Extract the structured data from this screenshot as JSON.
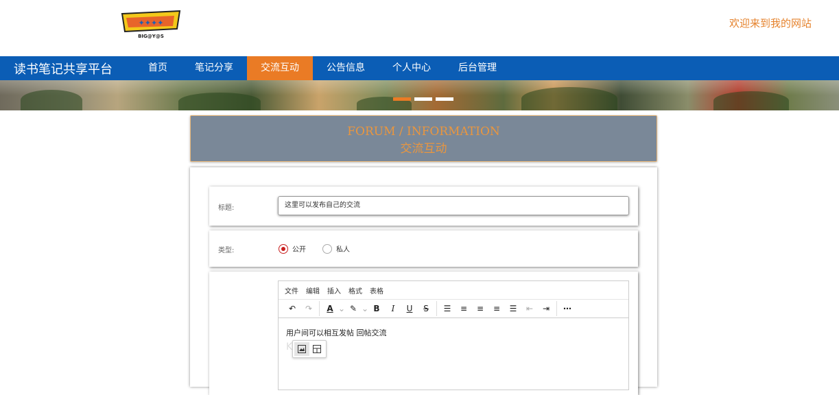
{
  "header": {
    "welcome": "欢迎来到我的网站",
    "logo_text": "BIG@Y@S"
  },
  "nav": {
    "brand": "读书笔记共享平台",
    "items": [
      "首页",
      "笔记分享",
      "交流互动",
      "公告信息",
      "个人中心",
      "后台管理"
    ],
    "active_index": 2,
    "color": "#0b5db5",
    "active_color": "#ea7b25"
  },
  "banner": {
    "active_slide": 0,
    "slide_count": 3
  },
  "section": {
    "title_en": "FORUM / INFORMATION",
    "title_cn": "交流互动"
  },
  "form": {
    "title_label": "标题:",
    "title_value": "这里可以发布自己的交流",
    "type_label": "类型:",
    "type_options": [
      "公开",
      "私人"
    ],
    "type_selected": 0,
    "editor": {
      "menus": [
        "文件",
        "编辑",
        "插入",
        "格式",
        "表格"
      ],
      "content": "用户间可以相互发帖 回帖交流"
    }
  }
}
